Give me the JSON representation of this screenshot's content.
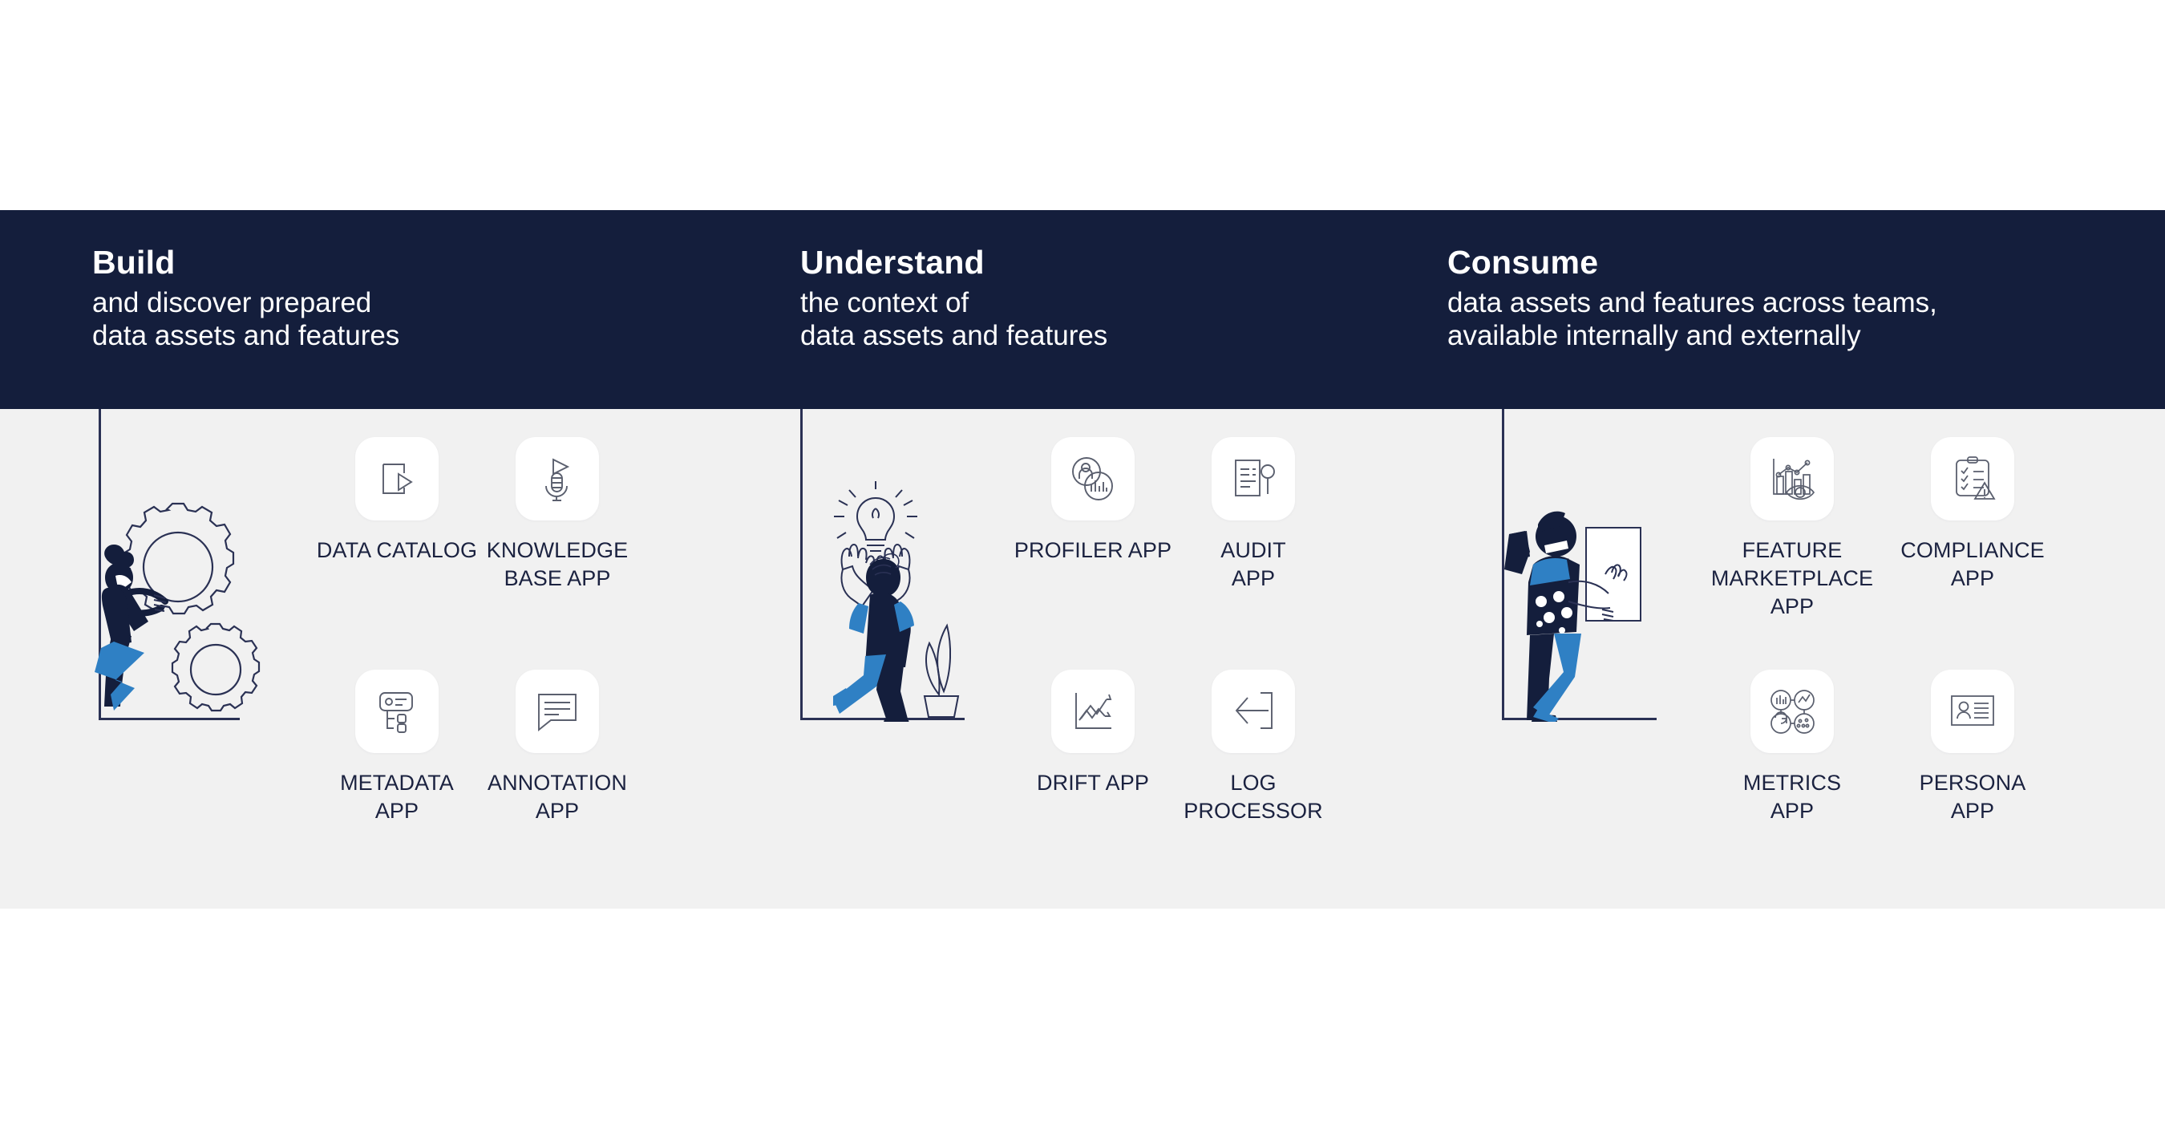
{
  "theme": {
    "navy": "#141E3C",
    "gray_band": "#F1F1F1",
    "page_bg": "#FFFFFF",
    "label_text": "#1B2240",
    "rule": "#2A3154",
    "accent_blue": "#2F80C4",
    "icon_stroke": "#5A5F6E"
  },
  "columns": [
    {
      "id": "build",
      "title": "Build",
      "subtitle_lines": [
        "and discover prepared",
        "data assets and features"
      ],
      "illustration": "person-pushing-gears-illustration",
      "apps": [
        {
          "label": "DATA CATALOG",
          "icon": "document-play-icon"
        },
        {
          "label": "KNOWLEDGE\nBASE APP",
          "icon": "microphone-play-icon"
        },
        {
          "label": "METADATA\nAPP",
          "icon": "metadata-node-tree-icon"
        },
        {
          "label": "ANNOTATION APP",
          "icon": "speech-bubble-lines-icon"
        }
      ]
    },
    {
      "id": "understand",
      "title": "Understand",
      "subtitle_lines": [
        "the context of",
        "data assets and features"
      ],
      "illustration": "person-lightbulb-idea-illustration",
      "apps": [
        {
          "label": "PROFILER APP",
          "icon": "profile-barchart-circles-icon"
        },
        {
          "label": "AUDIT\nAPP",
          "icon": "document-magnifier-icon"
        },
        {
          "label": "DRIFT APP",
          "icon": "line-chart-trend-arrows-icon"
        },
        {
          "label": "LOG PROCESSOR",
          "icon": "arrow-left-into-bracket-icon"
        }
      ]
    },
    {
      "id": "consume",
      "title": "Consume",
      "subtitle_lines": [
        "data assets and features across teams,",
        "available internally and externally"
      ],
      "illustration": "person-holding-panel-illustration",
      "apps": [
        {
          "label": "FEATURE\nMARKETPLACE APP",
          "icon": "barchart-linechart-eye-icon"
        },
        {
          "label": "COMPLIANCE\nAPP",
          "icon": "clipboard-checklist-warning-icon"
        },
        {
          "label": "METRICS\nAPP",
          "icon": "connected-chart-circles-icon"
        },
        {
          "label": "PERSONA\nAPP",
          "icon": "id-card-person-icon"
        }
      ]
    }
  ]
}
